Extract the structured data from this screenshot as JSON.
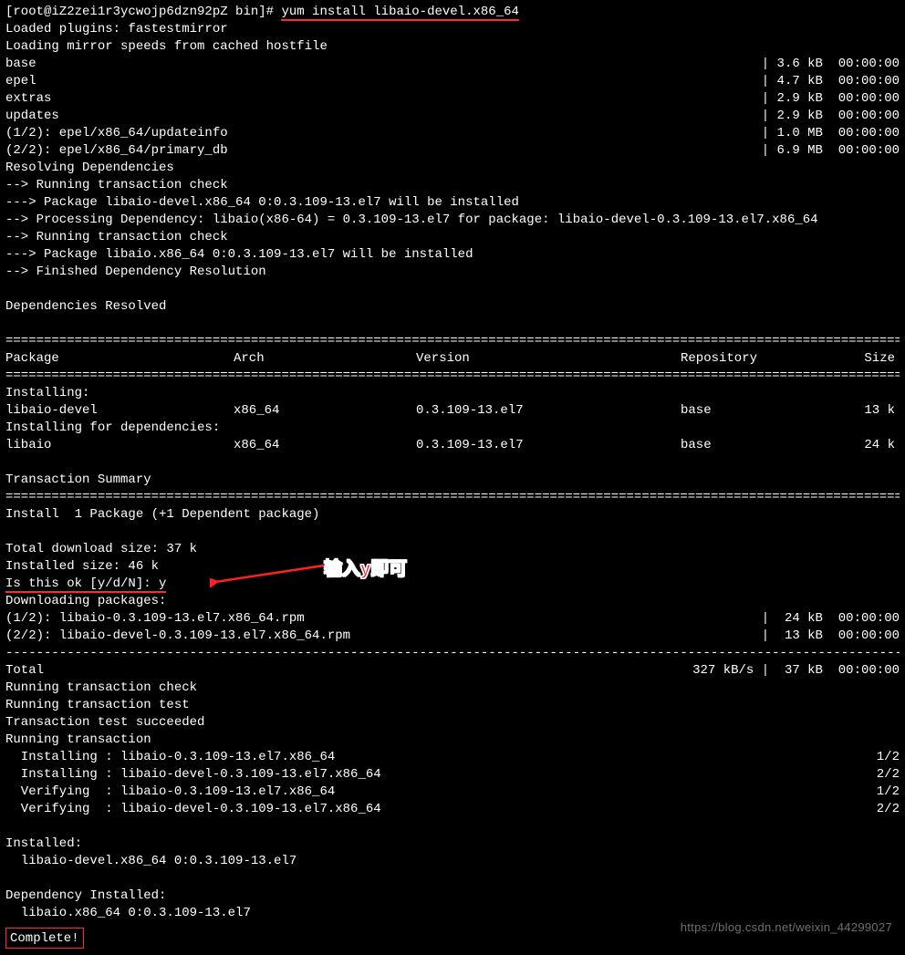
{
  "prompt": {
    "prefix": "[root@iZ2zei1r3ycwojp6dzn92pZ bin]# ",
    "command": "yum install libaio-devel.x86_64"
  },
  "preamble": [
    "Loaded plugins: fastestmirror",
    "Loading mirror speeds from cached hostfile"
  ],
  "repos": [
    {
      "name": "base",
      "size": "3.6 kB",
      "time": "00:00:00"
    },
    {
      "name": "epel",
      "size": "4.7 kB",
      "time": "00:00:00"
    },
    {
      "name": "extras",
      "size": "2.9 kB",
      "time": "00:00:00"
    },
    {
      "name": "updates",
      "size": "2.9 kB",
      "time": "00:00:00"
    }
  ],
  "repo_files": [
    {
      "label": "(1/2): epel/x86_64/updateinfo",
      "size": "1.0 MB",
      "time": "00:00:00"
    },
    {
      "label": "(2/2): epel/x86_64/primary_db",
      "size": "6.9 MB",
      "time": "00:00:00"
    }
  ],
  "resolving": [
    "Resolving Dependencies",
    "--> Running transaction check",
    "---> Package libaio-devel.x86_64 0:0.3.109-13.el7 will be installed",
    "--> Processing Dependency: libaio(x86-64) = 0.3.109-13.el7 for package: libaio-devel-0.3.109-13.el7.x86_64",
    "--> Running transaction check",
    "---> Package libaio.x86_64 0:0.3.109-13.el7 will be installed",
    "--> Finished Dependency Resolution"
  ],
  "deps_resolved": "Dependencies Resolved",
  "table_header": {
    "package": " Package",
    "arch": "Arch",
    "version": "Version",
    "repo": "Repository",
    "size": "Size"
  },
  "installing_label": "Installing:",
  "installing_dep_label": "Installing for dependencies:",
  "packages_install": [
    {
      "name": " libaio-devel",
      "arch": "x86_64",
      "version": "0.3.109-13.el7",
      "repo": "base",
      "size": "13 k"
    }
  ],
  "packages_dep": [
    {
      "name": " libaio",
      "arch": "x86_64",
      "version": "0.3.109-13.el7",
      "repo": "base",
      "size": "24 k"
    }
  ],
  "transaction_summary_label": "Transaction Summary",
  "install_summary": "Install  1 Package (+1 Dependent package)",
  "totals": [
    "Total download size: 37 k",
    "Installed size: 46 k"
  ],
  "confirm": {
    "prompt": "Is this ok [y/d/N]: ",
    "answer": "y"
  },
  "downloading_label": "Downloading packages:",
  "downloads": [
    {
      "label": "(1/2): libaio-0.3.109-13.el7.x86_64.rpm",
      "size": " 24 kB",
      "time": "00:00:00"
    },
    {
      "label": "(2/2): libaio-devel-0.3.109-13.el7.x86_64.rpm",
      "size": " 13 kB",
      "time": "00:00:00"
    }
  ],
  "total_line": {
    "label": "Total",
    "rate": "327 kB/s",
    "size": " 37 kB",
    "time": "00:00:00"
  },
  "transaction": [
    "Running transaction check",
    "Running transaction test",
    "Transaction test succeeded",
    "Running transaction"
  ],
  "trans_steps": [
    {
      "l": "  Installing : libaio-0.3.109-13.el7.x86_64",
      "r": "1/2"
    },
    {
      "l": "  Installing : libaio-devel-0.3.109-13.el7.x86_64",
      "r": "2/2"
    },
    {
      "l": "  Verifying  : libaio-0.3.109-13.el7.x86_64",
      "r": "1/2"
    },
    {
      "l": "  Verifying  : libaio-devel-0.3.109-13.el7.x86_64",
      "r": "2/2"
    }
  ],
  "installed_label": "Installed:",
  "installed_pkg": "  libaio-devel.x86_64 0:0.3.109-13.el7",
  "dep_installed_label": "Dependency Installed:",
  "dep_installed_pkg": "  libaio.x86_64 0:0.3.109-13.el7",
  "complete": "Complete!",
  "annotation_text": "输入y即可",
  "watermark": "https://blog.csdn.net/weixin_44299027",
  "divider_eq": "================================================================================================================================",
  "divider_dash": "--------------------------------------------------------------------------------------------------------------------------------"
}
